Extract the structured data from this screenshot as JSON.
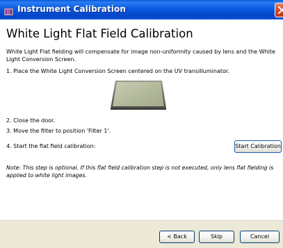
{
  "window": {
    "title": "Instrument Calibration",
    "icon": "app-icon",
    "close_icon": "close-icon"
  },
  "content": {
    "heading": "White Light Flat Field Calibration",
    "intro": "White Light Flat fielding will compensate for image non-uniformity caused by lens and the White Light Conversion Screen.",
    "step1": "1. Place the White Light Conversion Screen centered on the UV transilluminator.",
    "image": "white-light-conversion-screen-image",
    "step2": "2. Close the door.",
    "step3": "3. Move the filter to position 'Filter 1'.",
    "step4": "4. Start the flat field calibration:",
    "start_button": "Start Calibration",
    "note": "Note: This step is optional. If this flat field calibration step is not executed, only lens flat fielding is applied to white light images."
  },
  "footer": {
    "back": "< Back",
    "skip": "Skip",
    "cancel": "Cancel"
  },
  "colors": {
    "titlebar": "#0a5ae0",
    "footer_bg": "#ece9d8",
    "close_button": "#d0421f"
  }
}
